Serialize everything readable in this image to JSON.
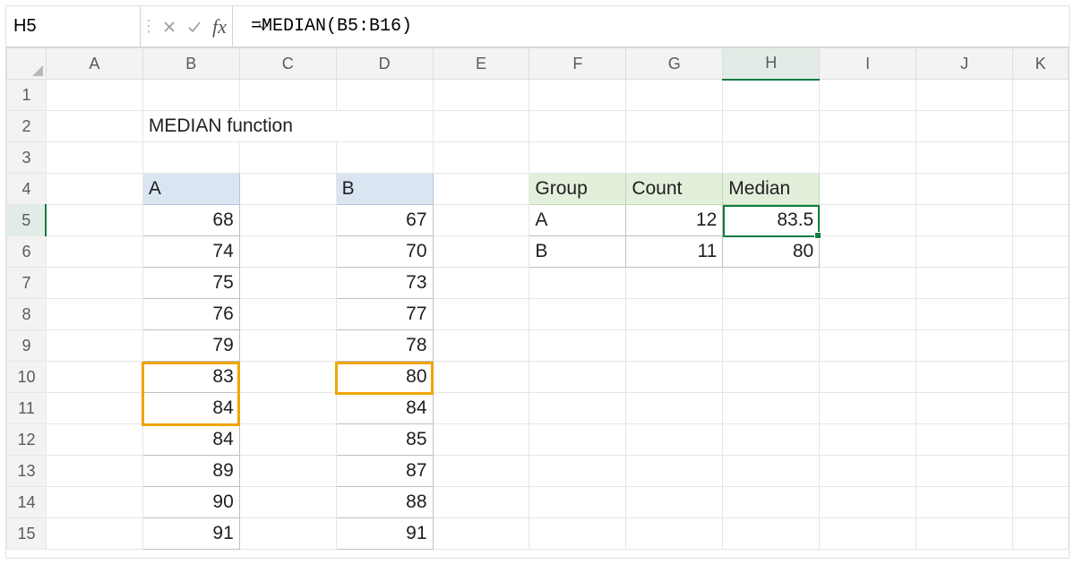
{
  "formula_bar": {
    "name_box": "H5",
    "formula": "=MEDIAN(B5:B16)"
  },
  "columns": [
    "A",
    "B",
    "C",
    "D",
    "E",
    "F",
    "G",
    "H",
    "I",
    "J",
    "K"
  ],
  "rows": [
    "1",
    "2",
    "3",
    "4",
    "5",
    "6",
    "7",
    "8",
    "9",
    "10",
    "11",
    "12",
    "13",
    "14",
    "15"
  ],
  "active": {
    "col": "H",
    "row": "5"
  },
  "title": "MEDIAN function",
  "series": {
    "A": {
      "header": "A",
      "values": [
        "68",
        "74",
        "75",
        "76",
        "79",
        "83",
        "84",
        "84",
        "89",
        "90",
        "91"
      ]
    },
    "B": {
      "header": "B",
      "values": [
        "67",
        "70",
        "73",
        "77",
        "78",
        "80",
        "84",
        "85",
        "87",
        "88",
        "91"
      ]
    }
  },
  "summary": {
    "headers": {
      "group": "Group",
      "count": "Count",
      "median": "Median"
    },
    "rows": [
      {
        "group": "A",
        "count": "12",
        "median": "83.5"
      },
      {
        "group": "B",
        "count": "11",
        "median": "80"
      }
    ]
  },
  "chart_data": {
    "type": "table",
    "title": "MEDIAN function",
    "series": [
      {
        "name": "A",
        "values": [
          68,
          74,
          75,
          76,
          79,
          83,
          84,
          84,
          89,
          90,
          91
        ]
      },
      {
        "name": "B",
        "values": [
          67,
          70,
          73,
          77,
          78,
          80,
          84,
          85,
          87,
          88,
          91
        ]
      }
    ],
    "summary": [
      {
        "group": "A",
        "count": 12,
        "median": 83.5
      },
      {
        "group": "B",
        "count": 11,
        "median": 80
      }
    ],
    "highlight": {
      "A": [
        83,
        84
      ],
      "B": [
        80
      ]
    }
  }
}
